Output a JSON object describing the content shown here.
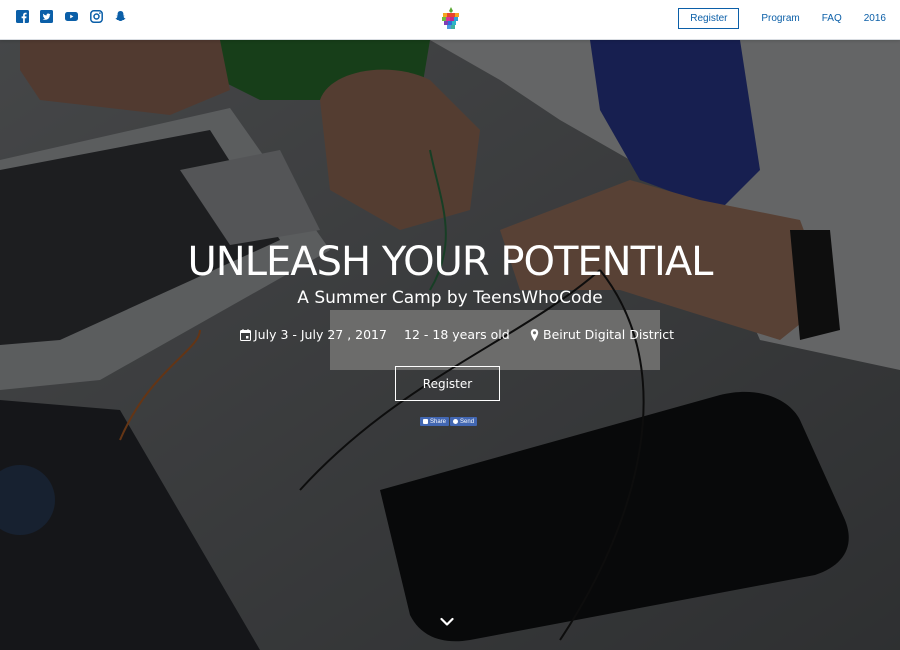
{
  "nav": {
    "social": [
      "facebook-icon",
      "twitter-icon",
      "youtube-icon",
      "instagram-icon",
      "snapchat-icon"
    ],
    "register_label": "Register",
    "links": [
      "Program",
      "FAQ",
      "2016"
    ]
  },
  "hero": {
    "title": "UNLEASH YOUR POTENTIAL",
    "subtitle": "A Summer Camp by TeensWhoCode",
    "dates": "July 3 - July 27 , 2017",
    "ages": "12 - 18 years old",
    "location": "Beirut Digital District",
    "register_label": "Register",
    "share_label": "Share",
    "send_label": "Send"
  },
  "colors": {
    "brand_blue": "#0b5fa8",
    "facebook_blue": "#4267b2",
    "hero_overlay": "rgba(0,0,0,0.5)"
  }
}
